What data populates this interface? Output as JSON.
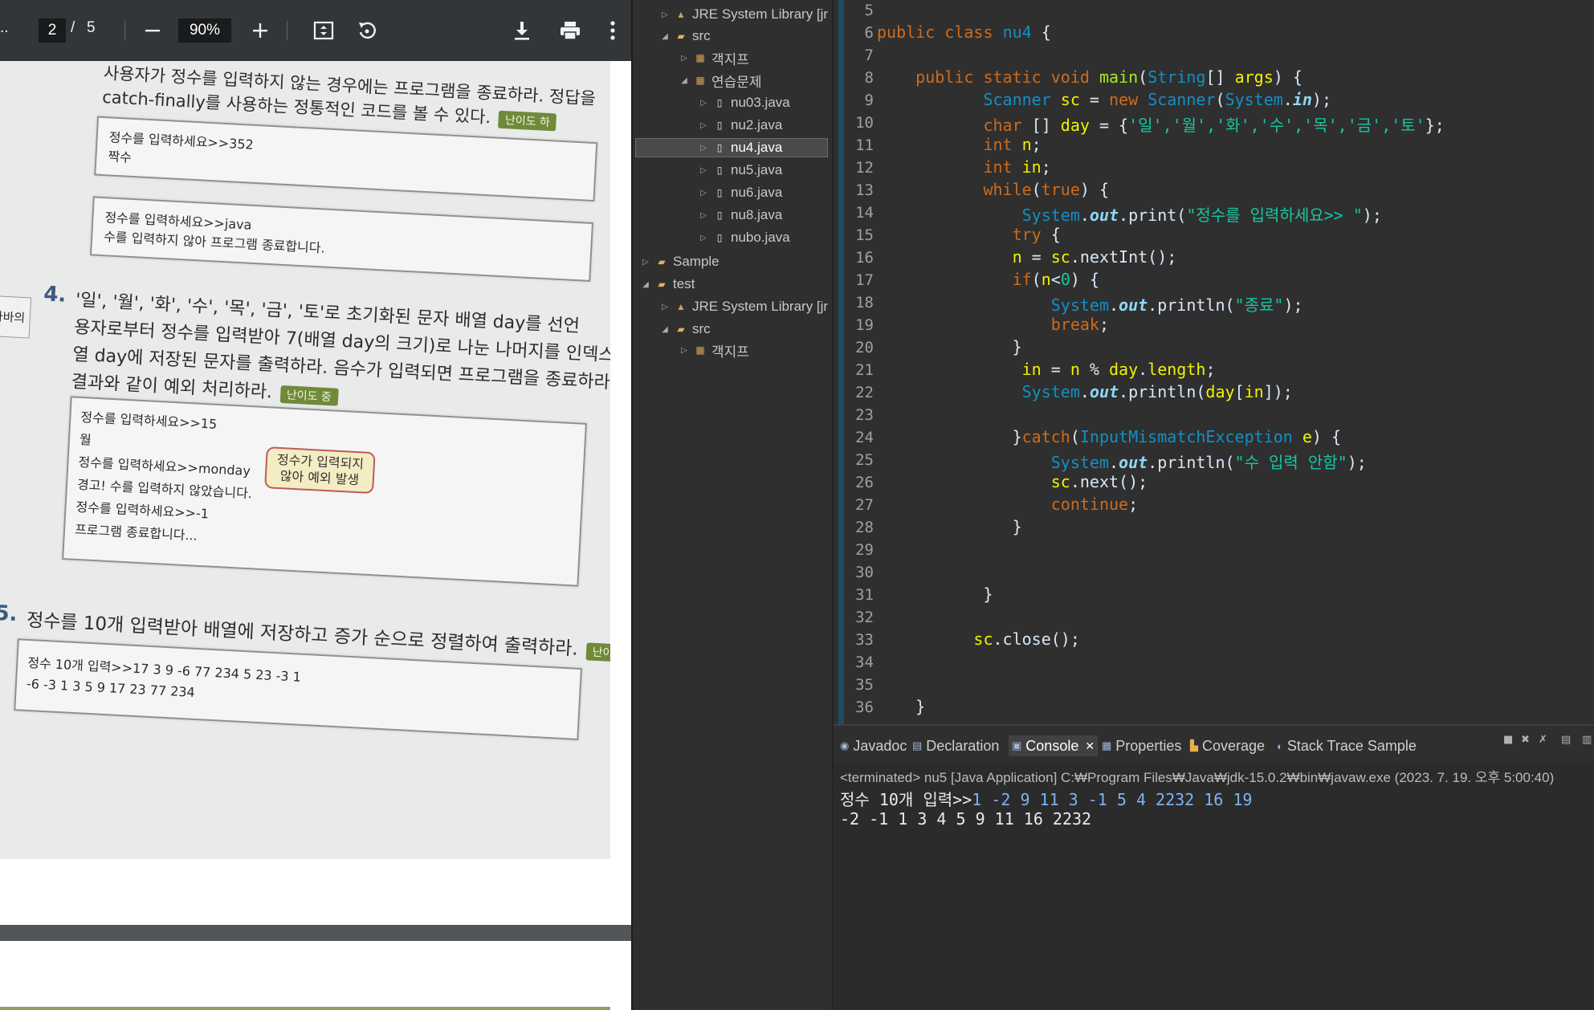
{
  "pdf": {
    "toolbar": {
      "menu_dots_left": "..",
      "page_current": "2",
      "page_sep": "/",
      "page_total": "5",
      "zoom": "90%"
    },
    "page": {
      "q3_line1": "사용자가 정수를 입력하지 않는 경우에는 프로그램을 종료하라. 정답을",
      "q3_line2": "catch-finally를 사용하는 정통적인 코드를 볼 수 있다.",
      "q3_badge": "난이도 하",
      "ex1_line1": "정수를 입력하세요>>352",
      "ex1_line2": "짝수",
      "ex2_line1": "정수를 입력하세요>>java",
      "ex2_line2": "수를 입력하지 않아 프로그램 종료합니다.",
      "side_tag": "자바의",
      "q4_num": "4.",
      "q4_line1": "'일', '월', '화', '수', '목', '금', '토'로 초기화된 문자 배열 day를 선언",
      "q4_line2": "용자로부터 정수를 입력받아 7(배열 day의 크기)로 나눈 나머지를 인덱스로",
      "q4_line3": "열 day에 저장된 문자를 출력하라. 음수가 입력되면 프로그램을 종료하라. 예",
      "q4_line4": "결과와 같이 예외 처리하라.",
      "q4_badge": "난이도 중",
      "ex3_line1": "정수를 입력하세요>>15",
      "ex3_line2": "월",
      "ex3_line3": "정수를 입력하세요>>monday",
      "ex3_line4": "경고! 수를 입력하지 않았습니다.",
      "ex3_line5": "정수를 입력하세요>>-1",
      "ex3_line6": "프로그램 종료합니다...",
      "callout_line1": "정수가 입력되지",
      "callout_line2": "않아 예외 발생",
      "q5_num": "5.",
      "q5_line1": "정수를 10개 입력받아 배열에 저장하고 증가 순으로 정렬하여 출력하라.",
      "q5_badge": "난이",
      "ex4_line1": "정수 10개 입력>>17 3 9 -6 77 234 5 23 -3 1",
      "ex4_line2": "-6 -3 1 3 5 9 17 23 77 234"
    }
  },
  "explorer": {
    "items": [
      {
        "label": "JRE System Library [jr",
        "icon": "library-icon"
      },
      {
        "label": "src",
        "icon": "package-folder-icon"
      },
      {
        "label": "객지프",
        "icon": "package-icon"
      },
      {
        "label": "연습문제",
        "icon": "package-icon"
      },
      {
        "label": "nu03.java",
        "icon": "java-file-icon"
      },
      {
        "label": "nu2.java",
        "icon": "java-file-icon"
      },
      {
        "label": "nu4.java",
        "icon": "java-file-icon"
      },
      {
        "label": "nu5.java",
        "icon": "java-file-icon"
      },
      {
        "label": "nu6.java",
        "icon": "java-file-icon"
      },
      {
        "label": "nu8.java",
        "icon": "java-file-icon"
      },
      {
        "label": "nubo.java",
        "icon": "java-file-icon"
      },
      {
        "label": "Sample",
        "icon": "project-icon"
      },
      {
        "label": "test",
        "icon": "project-icon"
      },
      {
        "label": "JRE System Library [jr",
        "icon": "library-icon"
      },
      {
        "label": "src",
        "icon": "package-folder-icon"
      },
      {
        "label": "객지프",
        "icon": "package-icon"
      }
    ],
    "selected": "nu4.java"
  },
  "editor": {
    "line_numbers": [
      "5",
      "6",
      "7",
      "8",
      "9",
      "10",
      "11",
      "12",
      "13",
      "14",
      "15",
      "16",
      "17",
      "18",
      "19",
      "20",
      "21",
      "22",
      "23",
      "24",
      "25",
      "26",
      "27",
      "28",
      "29",
      "30",
      "31",
      "32",
      "33",
      "34",
      "35",
      "36"
    ],
    "class_name": "nu4",
    "day_array": "'일','월','화','수','목','금','토'",
    "prompt_string": "\"정수를 입력하세요>> \"",
    "end_string": "\"종료\"",
    "error_string": "\"수 입력 안함\""
  },
  "console": {
    "tabs": [
      "Javadoc",
      "Declaration",
      "Console",
      "Properties",
      "Coverage",
      "Stack Trace Sample"
    ],
    "active_tab": "Console",
    "terminated_line": "<terminated> nu5 [Java Application] C:₩Program Files₩Java₩jdk-15.0.2₩bin₩javaw.exe (2023. 7. 19. 오후 5:00:40)",
    "prompt": "정수 10개 입력>>",
    "input": "1 -2 9 11 3 -1 5 4 2232 16 19",
    "output": "-2 -1 1 3 4 5 9 11 16 2232"
  },
  "colors": {
    "editor_bg": "#2f2f2f",
    "keyword": "#cc6c1d",
    "type": "#1290c3",
    "string": "#17c6a3",
    "variable": "#f2f200",
    "method": "#a7ec21"
  }
}
